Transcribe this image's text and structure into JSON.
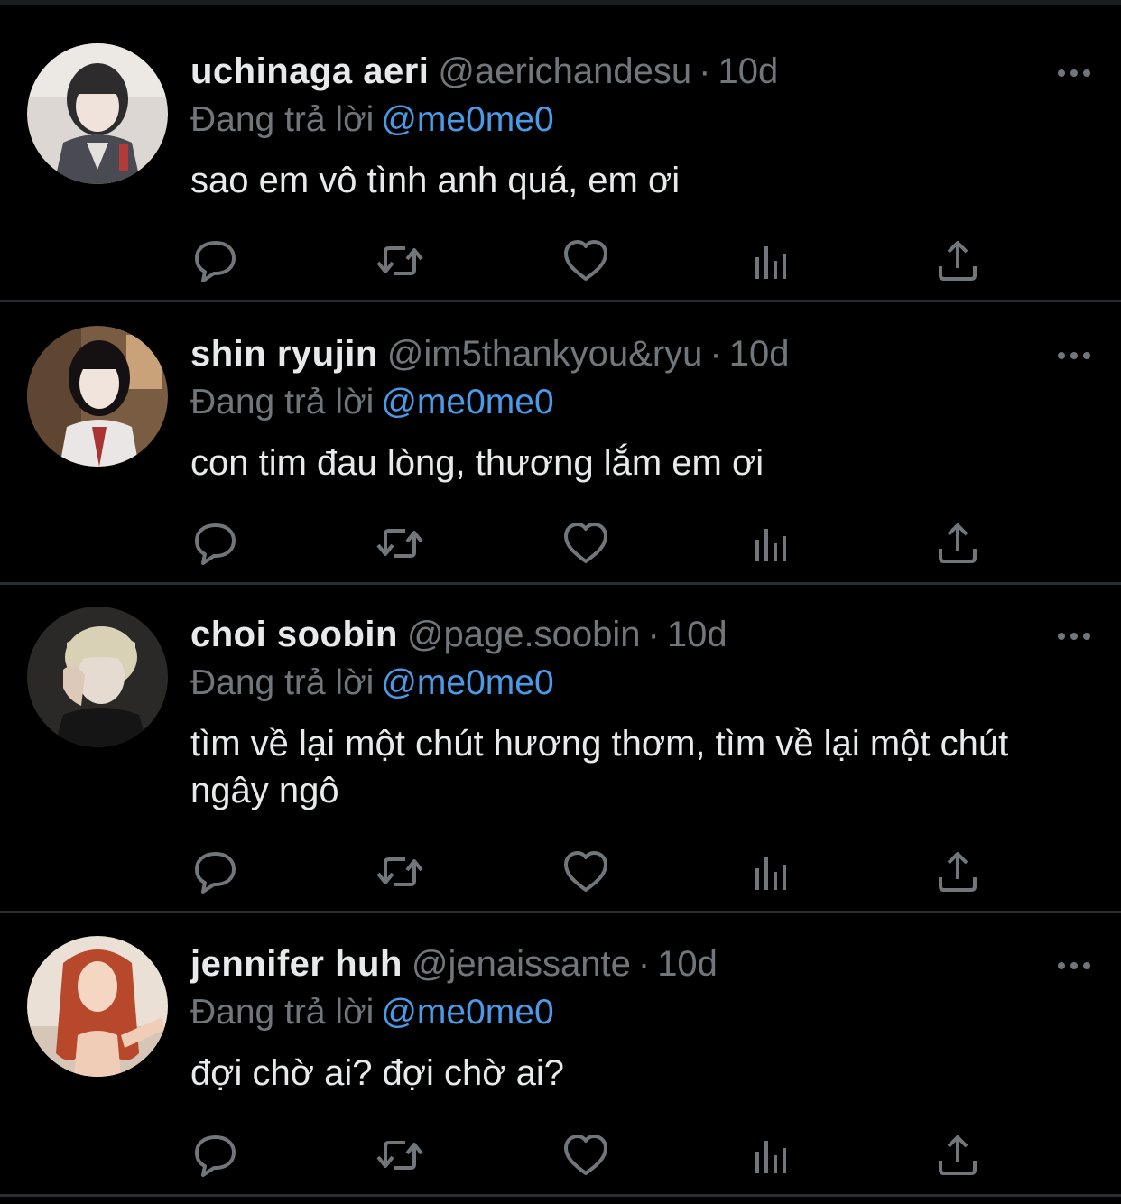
{
  "colors": {
    "background": "#000000",
    "text": "#e7e9ea",
    "muted": "#71767b",
    "mention": "#4a9ae8",
    "divider": "#2a2d31"
  },
  "icons": {
    "more": "more-horizontal-icon",
    "reply": "reply-bubble-icon",
    "retweet": "retweet-icon",
    "like": "heart-icon",
    "views": "views-bar-chart-icon",
    "share": "share-upload-icon"
  },
  "tweets": [
    {
      "display_name": "uchinaga aeri",
      "handle": "@aerichandesu",
      "separator": "·",
      "time": "10d",
      "reply_prefix": "Đang trả lời",
      "reply_to": "@me0me0",
      "text": "sao em vô tình anh quá, em ơi",
      "avatar_colors": [
        "#d9d4cf",
        "#3b3a3d",
        "#8c8f96"
      ]
    },
    {
      "display_name": "shin ryujin",
      "handle": "@im5thankyou&ryu",
      "separator": "·",
      "time": "10d",
      "reply_prefix": "Đang trả lời",
      "reply_to": "@me0me0",
      "text": "con tim đau lòng, thương lắm em ơi",
      "avatar_colors": [
        "#8a6a4c",
        "#1a1414",
        "#e9e4e2"
      ]
    },
    {
      "display_name": "choi soobin",
      "handle": "@page.soobin",
      "separator": "·",
      "time": "10d",
      "reply_prefix": "Đang trả lời",
      "reply_to": "@me0me0",
      "text": "tìm về lại một chút hương thơm, tìm về lại một chút ngây ngô",
      "avatar_colors": [
        "#2b2a28",
        "#d8d0b4",
        "#6b5f52"
      ]
    },
    {
      "display_name": "jennifer huh",
      "handle": "@jenaissante",
      "separator": "·",
      "time": "10d",
      "reply_prefix": "Đang trả lời",
      "reply_to": "@me0me0",
      "text": "đợi chờ ai? đợi chờ ai?",
      "avatar_colors": [
        "#e9dcd2",
        "#b5462a",
        "#f2c9b0"
      ]
    }
  ]
}
